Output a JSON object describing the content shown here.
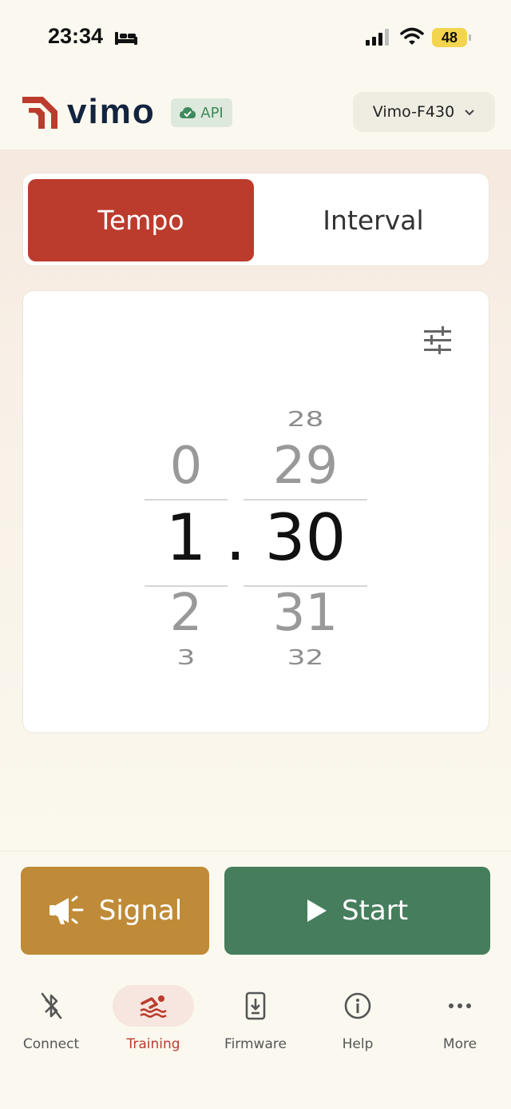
{
  "status_bar": {
    "time": "23:34",
    "battery": "48",
    "icons": [
      "bed-icon",
      "cellular-signal-icon",
      "wifi-icon",
      "battery-icon"
    ]
  },
  "header": {
    "logo_text": "vimo",
    "api_badge": "API",
    "device": "Vimo-F430"
  },
  "mode_tabs": [
    {
      "label": "Tempo",
      "active": true
    },
    {
      "label": "Interval",
      "active": false
    }
  ],
  "picker": {
    "minutes": {
      "above2": "",
      "above1": "0",
      "selected": "1",
      "below1": "2",
      "below2": "3"
    },
    "separator": ".",
    "seconds": {
      "above2": "28",
      "above1": "29",
      "selected": "30",
      "below1": "31",
      "below2": "32"
    }
  },
  "actions": {
    "signal_label": "Signal",
    "start_label": "Start"
  },
  "nav": [
    {
      "label": "Connect",
      "icon": "bluetooth-off-icon",
      "active": false
    },
    {
      "label": "Training",
      "icon": "swimming-icon",
      "active": true
    },
    {
      "label": "Firmware",
      "icon": "phone-download-icon",
      "active": false
    },
    {
      "label": "Help",
      "icon": "info-icon",
      "active": false
    },
    {
      "label": "More",
      "icon": "more-dots-icon",
      "active": false
    }
  ],
  "colors": {
    "brand_red": "#bb3c2d",
    "signal_gold": "#bf8b38",
    "start_green": "#467e5d",
    "navy": "#13243f"
  }
}
